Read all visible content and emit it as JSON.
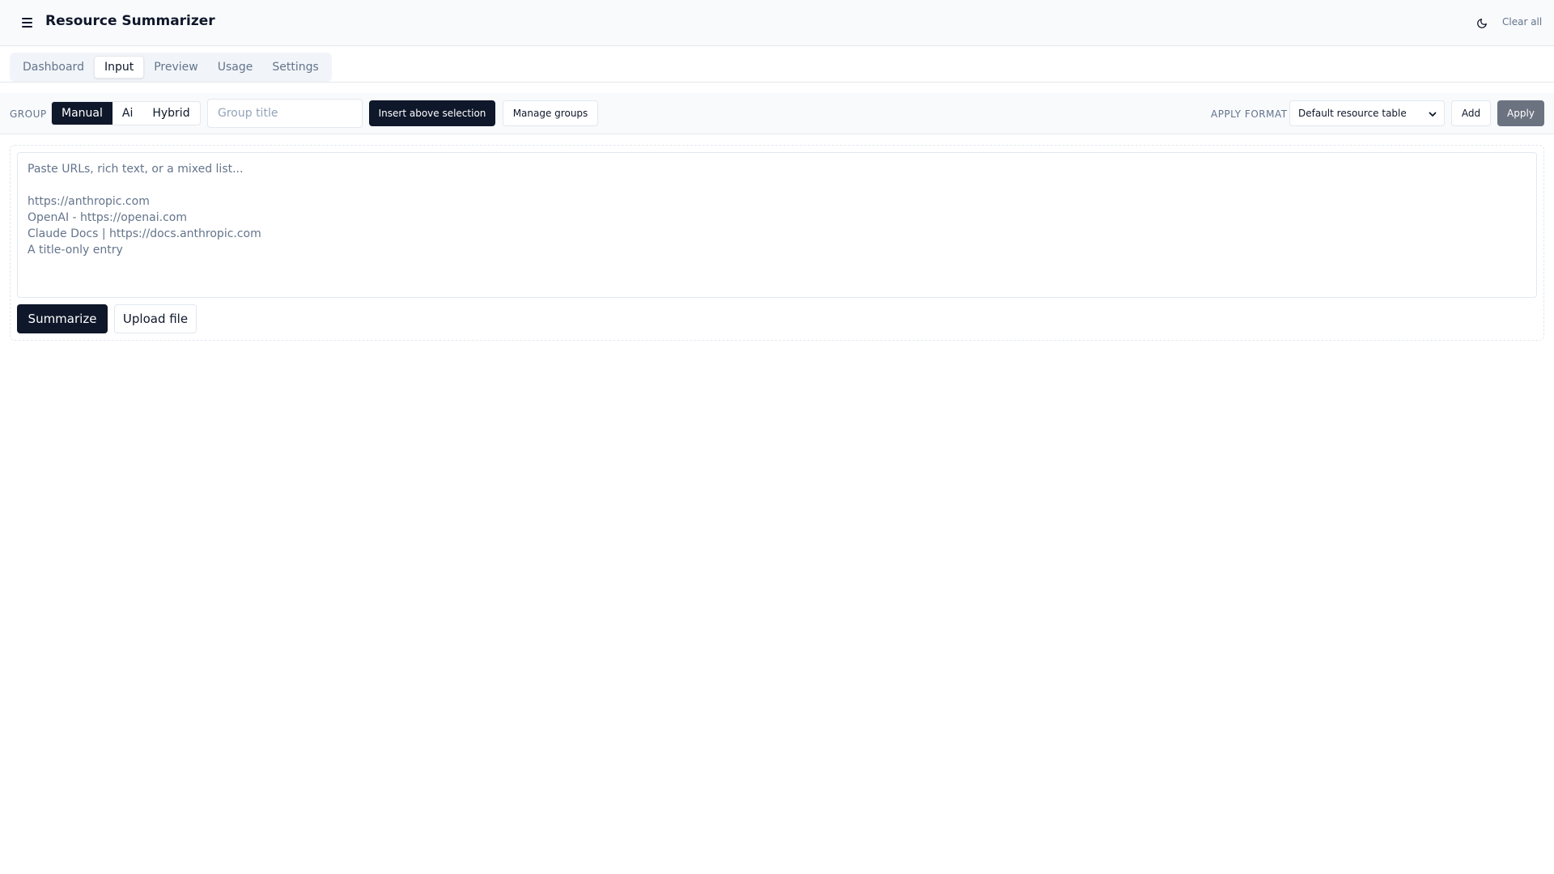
{
  "header": {
    "title": "Resource Summarizer",
    "menu_icon": "hamburger-icon",
    "theme_icon": "moon-icon",
    "clear_all_label": "Clear all"
  },
  "tabs": [
    {
      "label": "Dashboard",
      "active": false
    },
    {
      "label": "Input",
      "active": true
    },
    {
      "label": "Preview",
      "active": false
    },
    {
      "label": "Usage",
      "active": false
    },
    {
      "label": "Settings",
      "active": false
    }
  ],
  "toolbar": {
    "group_label": "GROUP",
    "modes": [
      {
        "label": "Manual",
        "active": true
      },
      {
        "label": "Ai",
        "active": false
      },
      {
        "label": "Hybrid",
        "active": false
      }
    ],
    "group_title_placeholder": "Group title",
    "group_title_value": "",
    "insert_label": "Insert above selection",
    "manage_label": "Manage groups",
    "apply_format_label": "APPLY FORMAT",
    "format_selected": "Default resource table",
    "add_label": "Add",
    "apply_label": "Apply"
  },
  "editor": {
    "placeholder": "Paste URLs, rich text, or a mixed list...\n\nhttps://anthropic.com\nOpenAI - https://openai.com\nClaude Docs | https://docs.anthropic.com\nA title-only entry",
    "value": "",
    "summarize_label": "Summarize",
    "upload_label": "Upload file"
  },
  "colors": {
    "primary": "#0f172a",
    "muted_text": "#64748b",
    "border": "#e2e8f0",
    "surface": "#f8fafc",
    "disabled": "#6b7280"
  }
}
